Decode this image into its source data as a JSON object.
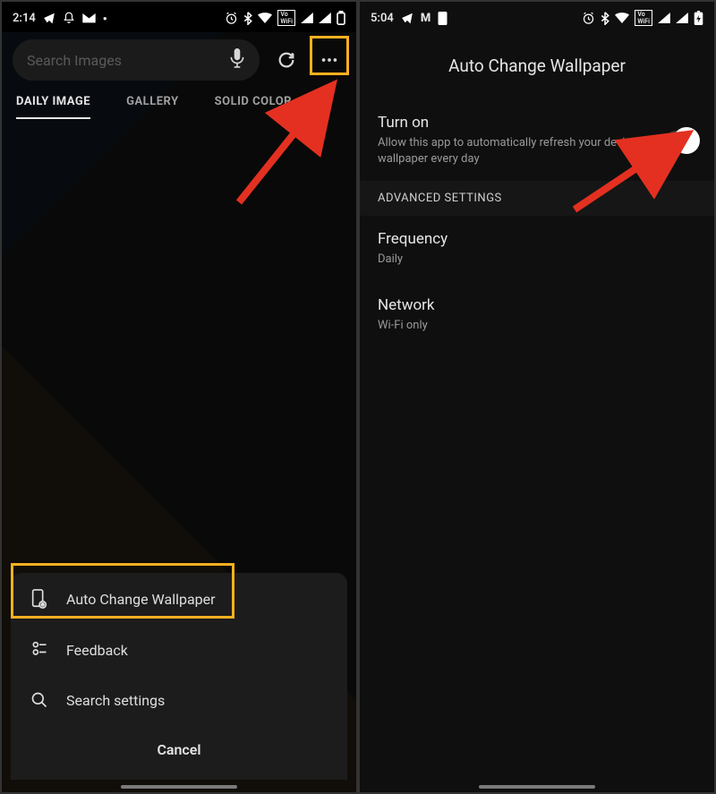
{
  "left": {
    "status": {
      "time": "2:14",
      "icons": [
        "telegram",
        "bell",
        "mail",
        "dot",
        "alarm",
        "bluetooth",
        "wifi",
        "wifibox",
        "signal1",
        "signal2",
        "battery-outline"
      ]
    },
    "search_placeholder": "Search Images",
    "tabs": [
      "DAILY IMAGE",
      "GALLERY",
      "SOLID COLOR"
    ],
    "menu": {
      "items": [
        {
          "icon": "phone-gear",
          "label": "Auto Change Wallpaper"
        },
        {
          "icon": "feedback",
          "label": "Feedback"
        },
        {
          "icon": "search",
          "label": "Search settings"
        }
      ],
      "cancel": "Cancel"
    }
  },
  "right": {
    "status": {
      "time": "5:04",
      "icons": [
        "telegram",
        "M",
        "phone-small",
        "alarm",
        "bluetooth",
        "wifi",
        "wifibox",
        "signal1",
        "signal2",
        "battery-bolt"
      ]
    },
    "title": "Auto Change Wallpaper",
    "turn_on": {
      "label": "Turn on",
      "desc": "Allow this app to automatically refresh your device's wallpaper every day"
    },
    "advanced": "ADVANCED SETTINGS",
    "freq": {
      "label": "Frequency",
      "value": "Daily"
    },
    "net": {
      "label": "Network",
      "value": "Wi-Fi only"
    }
  }
}
